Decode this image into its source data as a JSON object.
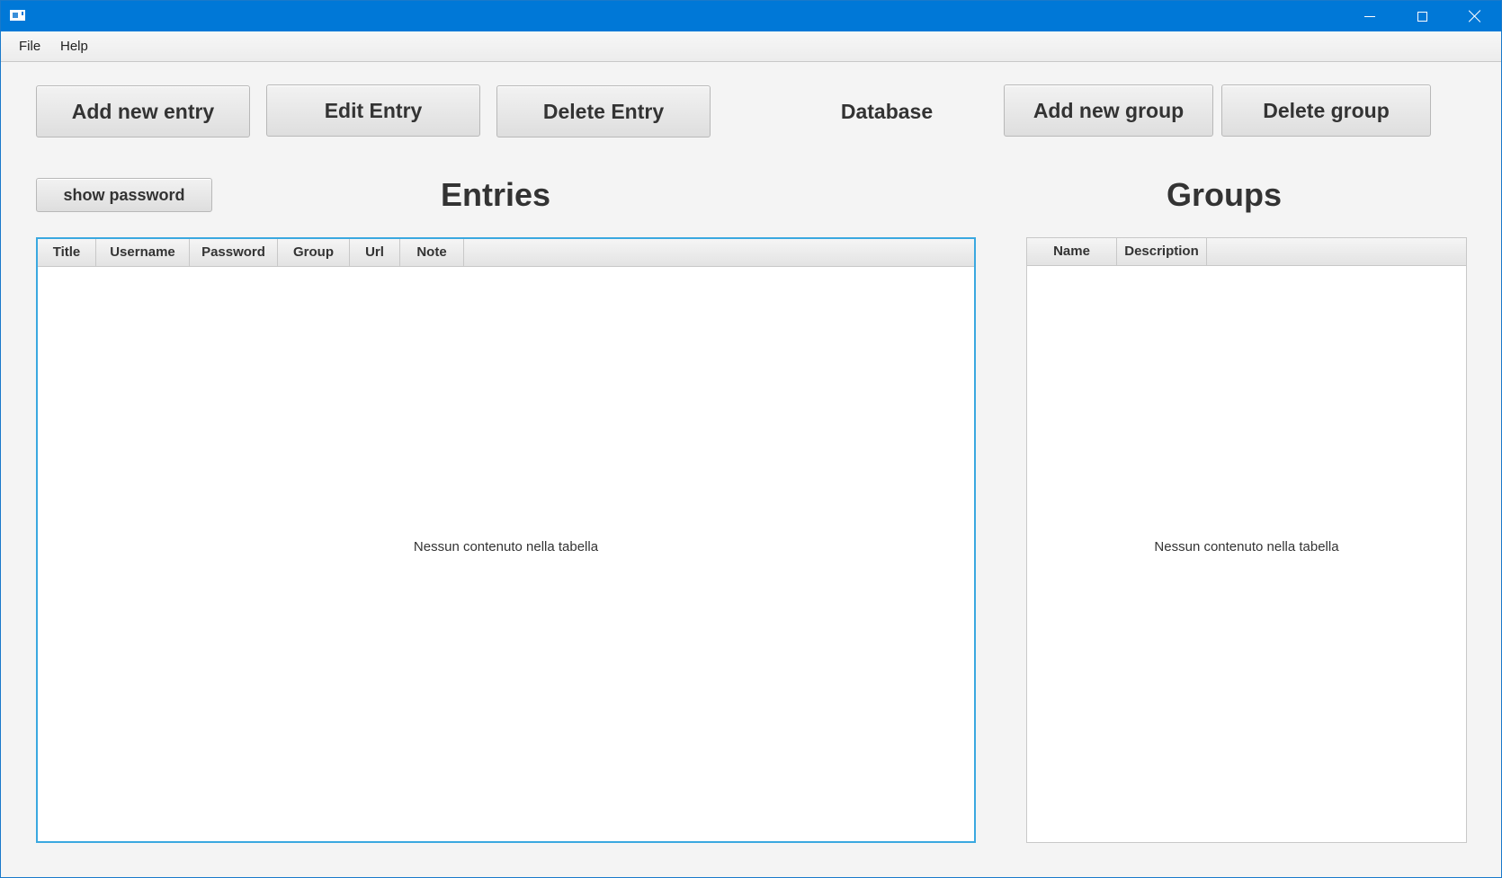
{
  "menu": {
    "file": "File",
    "help": "Help"
  },
  "toolbar": {
    "add_entry": "Add new entry",
    "edit_entry": "Edit Entry",
    "delete_entry": "Delete Entry",
    "database_label": "Database",
    "add_group": "Add new group",
    "delete_group": "Delete group",
    "show_password": "show password"
  },
  "entries": {
    "heading": "Entries",
    "columns": [
      "Title",
      "Username",
      "Password",
      "Group",
      "Url",
      "Note"
    ],
    "empty_message": "Nessun contenuto nella tabella"
  },
  "groups": {
    "heading": "Groups",
    "columns": [
      "Name",
      "Description"
    ],
    "empty_message": "Nessun contenuto nella tabella"
  },
  "colors": {
    "titlebar": "#0078d7",
    "focus_border": "#3aa8e0",
    "background": "#f4f4f4"
  }
}
